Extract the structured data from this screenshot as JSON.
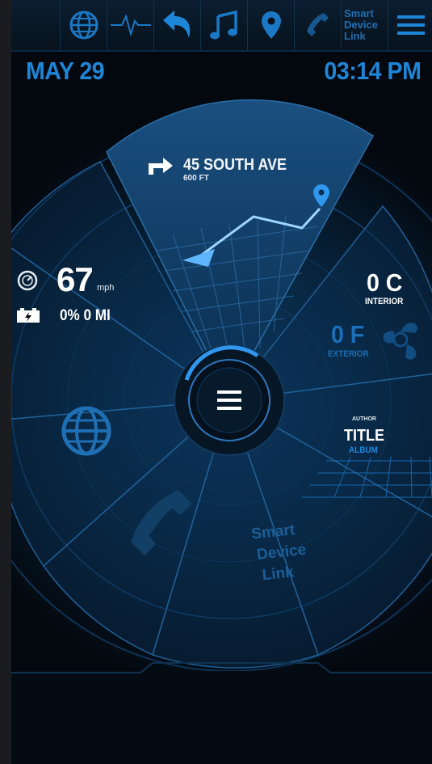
{
  "topbar": {
    "items": [
      {
        "name": "globe",
        "icon": "globe-icon"
      },
      {
        "name": "pulse",
        "icon": "heartbeat-icon"
      },
      {
        "name": "back",
        "icon": "undo-arrow-icon"
      },
      {
        "name": "music",
        "icon": "music-note-icon"
      },
      {
        "name": "location",
        "icon": "map-pin-icon"
      },
      {
        "name": "phone",
        "icon": "phone-icon"
      }
    ],
    "sdl_lines": [
      "Smart",
      "Device",
      "Link"
    ],
    "menu_icon": "hamburger-menu-icon"
  },
  "status": {
    "date": "MAY 29",
    "time": "03:14 PM"
  },
  "navigation": {
    "street": "45 SOUTH AVE",
    "distance": "600 FT",
    "turn_icon": "turn-right-arrow-icon"
  },
  "vehicle": {
    "speed": "67",
    "speed_unit": "mph",
    "speed_icon": "speedometer-icon",
    "battery": "0% 0 MI",
    "battery_icon": "battery-icon"
  },
  "climate": {
    "interior_temp": "0 C",
    "interior_label": "INTERIOR",
    "exterior_temp": "0 F",
    "exterior_label": "EXTERIOR"
  },
  "media": {
    "author": "AUTHOR",
    "title": "TITLE",
    "album": "ALBUM"
  },
  "wedge_sdl": [
    "Smart",
    "Device",
    "Link"
  ],
  "colors": {
    "accent": "#1e86d8",
    "dark_bg": "#03080e",
    "text_white": "#ffffff"
  }
}
